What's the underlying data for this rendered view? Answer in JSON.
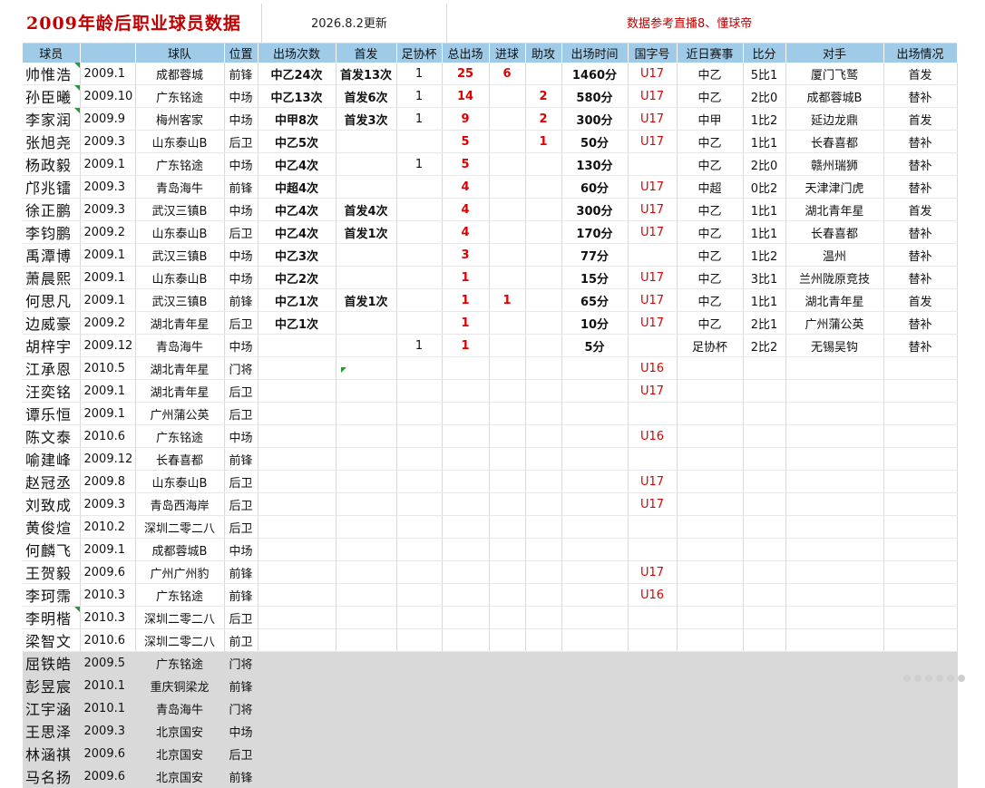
{
  "header": {
    "title": "2009年龄后职业球员数据",
    "update": "2026.8.2更新",
    "reference": "数据参考直播8、懂球帝"
  },
  "columns": [
    "球员",
    "",
    "球队",
    "位置",
    "出场次数",
    "首发",
    "足协杯",
    "总出场",
    "进球",
    "助攻",
    "出场时间",
    "国字号",
    "近日赛事",
    "比分",
    "对手",
    "出场情况"
  ],
  "rows": [
    {
      "name": "帅惟浩",
      "birth": "2009.1",
      "team": "成都蓉城",
      "pos": "前锋",
      "apps": "中乙24次",
      "starts": "首发13次",
      "fa": "1",
      "total": "25",
      "goals": "6",
      "assists": "",
      "minutes": "1460分",
      "nt": "U17",
      "recent": "中乙",
      "score": "5比1",
      "opp": "厦门飞鹫",
      "status": "首发",
      "mark": true
    },
    {
      "name": "孙臣曦",
      "birth": "2009.10",
      "team": "广东铭途",
      "pos": "中场",
      "apps": "中乙13次",
      "starts": "首发6次",
      "fa": "1",
      "total": "14",
      "goals": "",
      "assists": "2",
      "minutes": "580分",
      "nt": "U17",
      "recent": "中乙",
      "score": "2比0",
      "opp": "成都蓉城B",
      "status": "替补",
      "mark": true
    },
    {
      "name": "李家润",
      "birth": "2009.9",
      "team": "梅州客家",
      "pos": "中场",
      "apps": "中甲8次",
      "starts": "首发3次",
      "fa": "1",
      "total": "9",
      "goals": "",
      "assists": "2",
      "minutes": "300分",
      "nt": "U17",
      "recent": "中甲",
      "score": "1比2",
      "opp": "延边龙鼎",
      "status": "首发",
      "mark": true
    },
    {
      "name": "张旭尧",
      "birth": "2009.3",
      "team": "山东泰山B",
      "pos": "后卫",
      "apps": "中乙5次",
      "starts": "",
      "fa": "",
      "total": "5",
      "goals": "",
      "assists": "1",
      "minutes": "50分",
      "nt": "U17",
      "recent": "中乙",
      "score": "1比1",
      "opp": "长春喜都",
      "status": "替补",
      "mark": false
    },
    {
      "name": "杨政毅",
      "birth": "2009.1",
      "team": "广东铭途",
      "pos": "中场",
      "apps": "中乙4次",
      "starts": "",
      "fa": "1",
      "total": "5",
      "goals": "",
      "assists": "",
      "minutes": "130分",
      "nt": "",
      "recent": "中乙",
      "score": "2比0",
      "opp": "赣州瑞狮",
      "status": "替补",
      "mark": false
    },
    {
      "name": "邝兆镭",
      "birth": "2009.3",
      "team": "青岛海牛",
      "pos": "前锋",
      "apps": "中超4次",
      "starts": "",
      "fa": "",
      "total": "4",
      "goals": "",
      "assists": "",
      "minutes": "60分",
      "nt": "U17",
      "recent": "中超",
      "score": "0比2",
      "opp": "天津津门虎",
      "status": "替补",
      "mark": false
    },
    {
      "name": "徐正鹏",
      "birth": "2009.3",
      "team": "武汉三镇B",
      "pos": "中场",
      "apps": "中乙4次",
      "starts": "首发4次",
      "fa": "",
      "total": "4",
      "goals": "",
      "assists": "",
      "minutes": "300分",
      "nt": "U17",
      "recent": "中乙",
      "score": "1比1",
      "opp": "湖北青年星",
      "status": "首发",
      "mark": false
    },
    {
      "name": "李钧鹏",
      "birth": "2009.2",
      "team": "山东泰山B",
      "pos": "后卫",
      "apps": "中乙4次",
      "starts": "首发1次",
      "fa": "",
      "total": "4",
      "goals": "",
      "assists": "",
      "minutes": "170分",
      "nt": "U17",
      "recent": "中乙",
      "score": "1比1",
      "opp": "长春喜都",
      "status": "替补",
      "mark": false
    },
    {
      "name": "禹潭博",
      "birth": "2009.1",
      "team": "武汉三镇B",
      "pos": "中场",
      "apps": "中乙3次",
      "starts": "",
      "fa": "",
      "total": "3",
      "goals": "",
      "assists": "",
      "minutes": "77分",
      "nt": "",
      "recent": "中乙",
      "score": "1比2",
      "opp": "温州",
      "status": "替补",
      "mark": false
    },
    {
      "name": "萧晨熙",
      "birth": "2009.1",
      "team": "山东泰山B",
      "pos": "中场",
      "apps": "中乙2次",
      "starts": "",
      "fa": "",
      "total": "1",
      "goals": "",
      "assists": "",
      "minutes": "15分",
      "nt": "U17",
      "recent": "中乙",
      "score": "3比1",
      "opp": "兰州陇原竞技",
      "status": "替补",
      "mark": false
    },
    {
      "name": "何思凡",
      "birth": "2009.1",
      "team": "武汉三镇B",
      "pos": "前锋",
      "apps": "中乙1次",
      "starts": "首发1次",
      "fa": "",
      "total": "1",
      "goals": "1",
      "assists": "",
      "minutes": "65分",
      "nt": "U17",
      "recent": "中乙",
      "score": "1比1",
      "opp": "湖北青年星",
      "status": "首发",
      "mark": false
    },
    {
      "name": "边威豪",
      "birth": "2009.2",
      "team": "湖北青年星",
      "pos": "后卫",
      "apps": "中乙1次",
      "starts": "",
      "fa": "",
      "total": "1",
      "goals": "",
      "assists": "",
      "minutes": "10分",
      "nt": "U17",
      "recent": "中乙",
      "score": "2比1",
      "opp": "广州蒲公英",
      "status": "替补",
      "mark": false
    },
    {
      "name": "胡梓宇",
      "birth": "2009.12",
      "team": "青岛海牛",
      "pos": "中场",
      "apps": "",
      "starts": "",
      "fa": "1",
      "total": "1",
      "goals": "",
      "assists": "",
      "minutes": "5分",
      "nt": "",
      "recent": "足协杯",
      "score": "2比2",
      "opp": "无锡吴钩",
      "status": "替补",
      "mark": false
    },
    {
      "name": "江承恩",
      "birth": "2010.5",
      "team": "湖北青年星",
      "pos": "门将",
      "apps": "",
      "starts": "",
      "fa": "",
      "total": "",
      "goals": "",
      "assists": "",
      "minutes": "",
      "nt": "U16",
      "recent": "",
      "score": "",
      "opp": "",
      "status": "",
      "mark": false
    },
    {
      "name": "汪奕铭",
      "birth": "2009.1",
      "team": "湖北青年星",
      "pos": "后卫",
      "apps": "",
      "starts": "",
      "fa": "",
      "total": "",
      "goals": "",
      "assists": "",
      "minutes": "",
      "nt": "U17",
      "recent": "",
      "score": "",
      "opp": "",
      "status": "",
      "mark": false
    },
    {
      "name": "谭乐恒",
      "birth": "2009.1",
      "team": "广州蒲公英",
      "pos": "后卫",
      "apps": "",
      "starts": "",
      "fa": "",
      "total": "",
      "goals": "",
      "assists": "",
      "minutes": "",
      "nt": "",
      "recent": "",
      "score": "",
      "opp": "",
      "status": "",
      "mark": false
    },
    {
      "name": "陈文泰",
      "birth": "2010.6",
      "team": "广东铭途",
      "pos": "中场",
      "apps": "",
      "starts": "",
      "fa": "",
      "total": "",
      "goals": "",
      "assists": "",
      "minutes": "",
      "nt": "U16",
      "recent": "",
      "score": "",
      "opp": "",
      "status": "",
      "mark": false
    },
    {
      "name": "喻建峰",
      "birth": "2009.12",
      "team": "长春喜都",
      "pos": "前锋",
      "apps": "",
      "starts": "",
      "fa": "",
      "total": "",
      "goals": "",
      "assists": "",
      "minutes": "",
      "nt": "",
      "recent": "",
      "score": "",
      "opp": "",
      "status": "",
      "mark": false
    },
    {
      "name": "赵冠丞",
      "birth": "2009.8",
      "team": "山东泰山B",
      "pos": "后卫",
      "apps": "",
      "starts": "",
      "fa": "",
      "total": "",
      "goals": "",
      "assists": "",
      "minutes": "",
      "nt": "U17",
      "recent": "",
      "score": "",
      "opp": "",
      "status": "",
      "mark": false
    },
    {
      "name": "刘致成",
      "birth": "2009.3",
      "team": "青岛西海岸",
      "pos": "后卫",
      "apps": "",
      "starts": "",
      "fa": "",
      "total": "",
      "goals": "",
      "assists": "",
      "minutes": "",
      "nt": "U17",
      "recent": "",
      "score": "",
      "opp": "",
      "status": "",
      "mark": false
    },
    {
      "name": "黄俊煊",
      "birth": "2010.2",
      "team": "深圳二零二八",
      "pos": "后卫",
      "apps": "",
      "starts": "",
      "fa": "",
      "total": "",
      "goals": "",
      "assists": "",
      "minutes": "",
      "nt": "",
      "recent": "",
      "score": "",
      "opp": "",
      "status": "",
      "mark": false
    },
    {
      "name": "何麟飞",
      "birth": "2009.1",
      "team": "成都蓉城B",
      "pos": "中场",
      "apps": "",
      "starts": "",
      "fa": "",
      "total": "",
      "goals": "",
      "assists": "",
      "minutes": "",
      "nt": "",
      "recent": "",
      "score": "",
      "opp": "",
      "status": "",
      "mark": false
    },
    {
      "name": "王贺毅",
      "birth": "2009.6",
      "team": "广州广州豹",
      "pos": "前锋",
      "apps": "",
      "starts": "",
      "fa": "",
      "total": "",
      "goals": "",
      "assists": "",
      "minutes": "",
      "nt": "U17",
      "recent": "",
      "score": "",
      "opp": "",
      "status": "",
      "mark": false
    },
    {
      "name": "李珂霈",
      "birth": "2010.3",
      "team": "广东铭途",
      "pos": "前锋",
      "apps": "",
      "starts": "",
      "fa": "",
      "total": "",
      "goals": "",
      "assists": "",
      "minutes": "",
      "nt": "U16",
      "recent": "",
      "score": "",
      "opp": "",
      "status": "",
      "mark": false
    },
    {
      "name": "李明楷",
      "birth": "2010.3",
      "team": "深圳二零二八",
      "pos": "后卫",
      "apps": "",
      "starts": "",
      "fa": "",
      "total": "",
      "goals": "",
      "assists": "",
      "minutes": "",
      "nt": "",
      "recent": "",
      "score": "",
      "opp": "",
      "status": "",
      "mark": true
    },
    {
      "name": "梁智文",
      "birth": "2010.6",
      "team": "深圳二零二八",
      "pos": "前卫",
      "apps": "",
      "starts": "",
      "fa": "",
      "total": "",
      "goals": "",
      "assists": "",
      "minutes": "",
      "nt": "",
      "recent": "",
      "score": "",
      "opp": "",
      "status": "",
      "mark": false
    },
    {
      "name": "屈铁皓",
      "birth": "2009.5",
      "team": "广东铭途",
      "pos": "门将",
      "gray": true
    },
    {
      "name": "彭昱宸",
      "birth": "2010.1",
      "team": "重庆铜梁龙",
      "pos": "前锋",
      "gray": true
    },
    {
      "name": "江宇涵",
      "birth": "2010.1",
      "team": "青岛海牛",
      "pos": "门将",
      "gray": true
    },
    {
      "name": "王思泽",
      "birth": "2009.3",
      "team": "北京国安",
      "pos": "中场",
      "gray": true
    },
    {
      "name": "林涵祺",
      "birth": "2009.6",
      "team": "北京国安",
      "pos": "后卫",
      "gray": true
    },
    {
      "name": "马名扬",
      "birth": "2009.6",
      "team": "北京国安",
      "pos": "前锋",
      "gray": true
    }
  ]
}
